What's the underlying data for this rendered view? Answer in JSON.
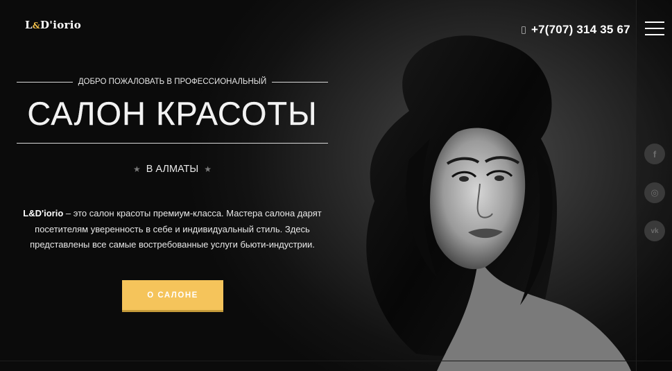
{
  "header": {
    "logo": {
      "prefix": "L",
      "amp": "&",
      "name": "D'iorio"
    },
    "phone": "+7(707) 314 35 67",
    "menu_icon": "hamburger-icon",
    "phone_icon": "mobile-phone-icon"
  },
  "hero": {
    "welcome": "ДОБРО ПОЖАЛОВАТЬ В ПРОФЕССИОНАЛЬНЫЙ",
    "title": "САЛОН КРАСОТЫ",
    "city": "В АЛМАТЫ",
    "description_brand": "L&D'iorio",
    "description_rest": " – это салон красоты премиум-класса. Мастера салона дарят посетителям уверенность в себе и индивидуальный стиль. Здесь представлены все самые востребованные услуги бьюти-индустрии.",
    "cta_label": "О САЛОНЕ"
  },
  "social": [
    {
      "name": "facebook-icon",
      "glyph": "f"
    },
    {
      "name": "instagram-icon",
      "glyph": "◎"
    },
    {
      "name": "vk-icon",
      "glyph": "vk"
    }
  ],
  "colors": {
    "accent": "#f5c45b",
    "background": "#0b0b0b"
  }
}
